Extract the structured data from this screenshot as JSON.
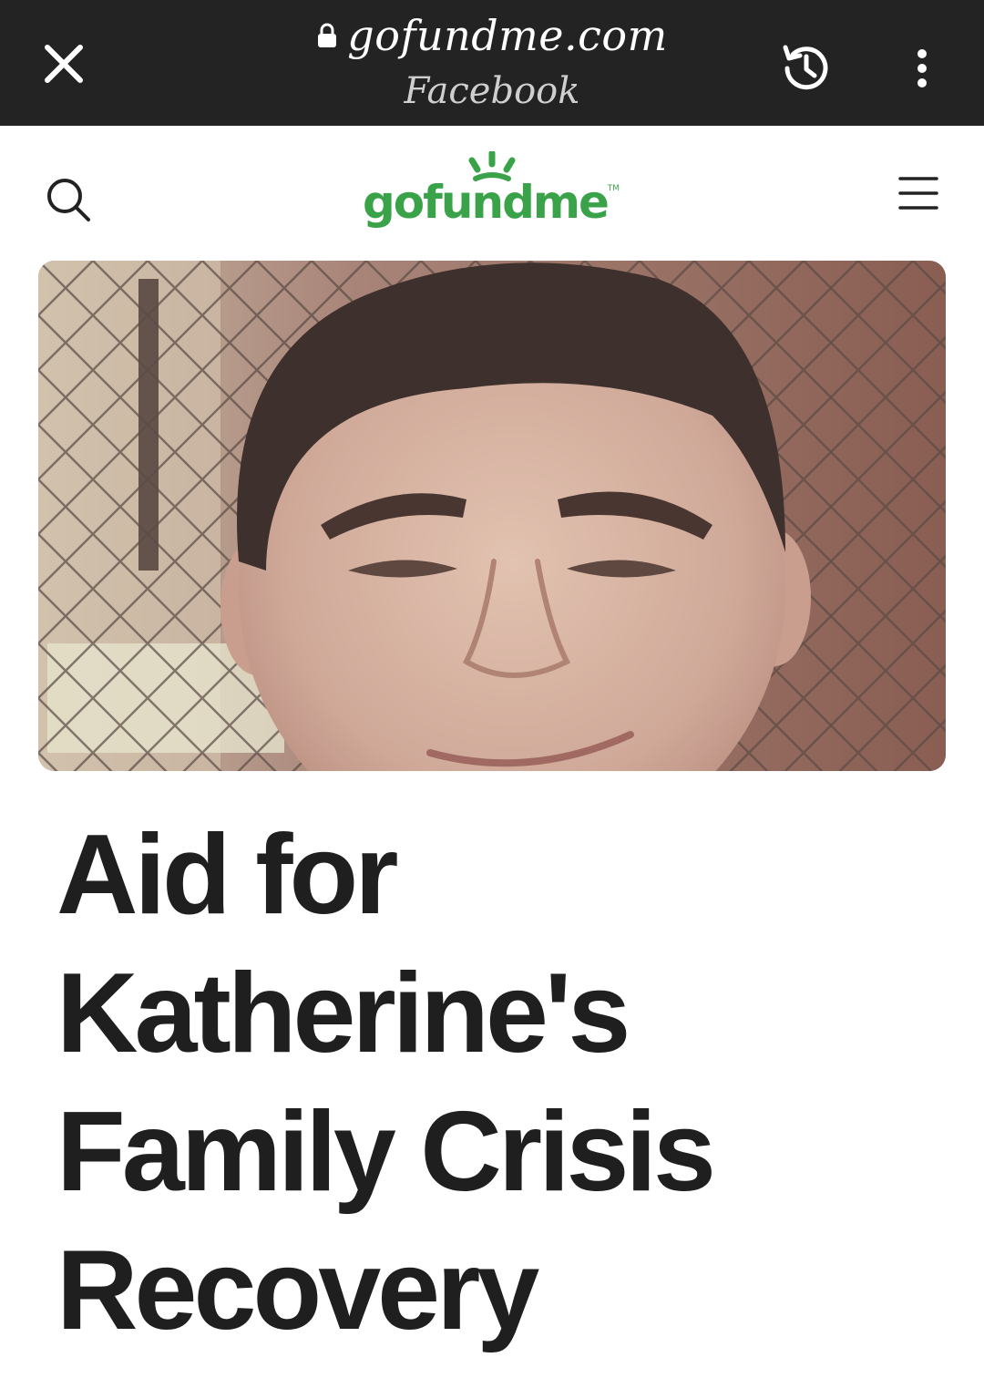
{
  "browser": {
    "url": "gofundme.com",
    "source": "Facebook",
    "close_icon": "close-icon",
    "lock_icon": "lock-icon",
    "history_icon": "history-icon",
    "more_icon": "more-vertical-icon"
  },
  "header": {
    "logo_text": "gofundme",
    "logo_tm": "TM",
    "search_icon": "search-icon",
    "menu_icon": "hamburger-menu-icon",
    "brand_color": "#3aa34a"
  },
  "campaign": {
    "hero_image": "campaign-photo",
    "title_lines": [
      "Aid for",
      "Katherine's",
      "Family Crisis",
      "Recovery"
    ]
  }
}
